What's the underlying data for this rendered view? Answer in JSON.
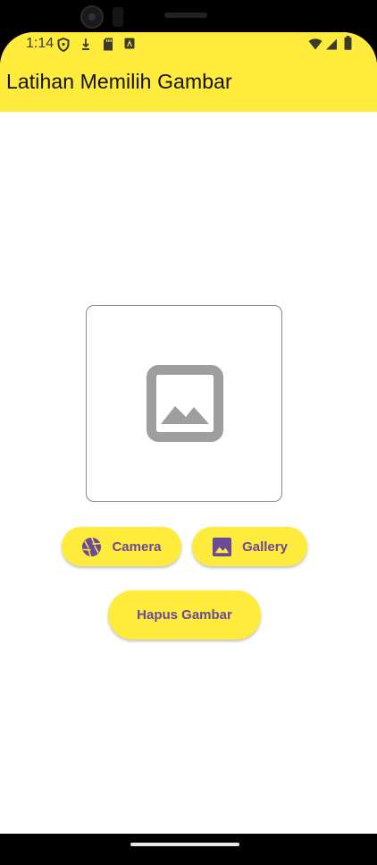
{
  "status_bar": {
    "time": "1:14"
  },
  "app_bar": {
    "title": "Latihan Memilih Gambar",
    "color": "#ffeb3b"
  },
  "image_preview": {
    "placeholder_icon": "image-placeholder-icon"
  },
  "buttons": {
    "camera": {
      "label": "Camera",
      "icon": "camera-aperture-icon"
    },
    "gallery": {
      "label": "Gallery",
      "icon": "image-icon"
    },
    "delete": {
      "label": "Hapus Gambar"
    }
  },
  "colors": {
    "button_bg": "#ffeb3b",
    "button_text": "#6a4a9a",
    "placeholder_icon": "#9e9e9e"
  }
}
